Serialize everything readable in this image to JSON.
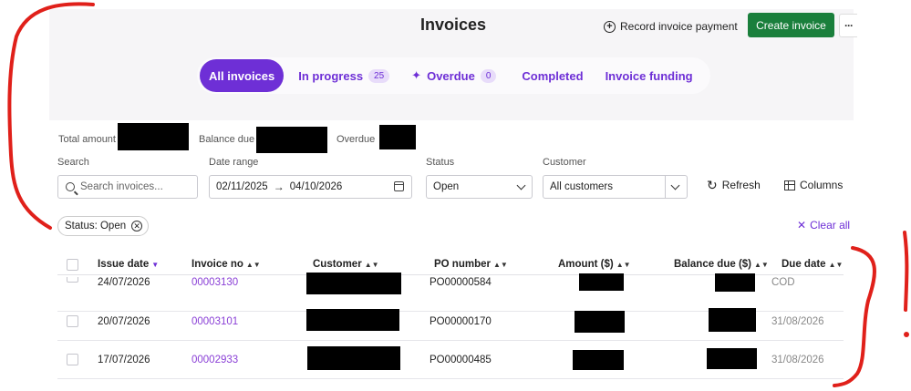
{
  "header": {
    "title": "Invoices",
    "record_payment_label": "Record invoice payment",
    "create_label": "Create invoice",
    "more_label": "···"
  },
  "tabs": [
    {
      "label": "All invoices",
      "active": true
    },
    {
      "label": "In progress",
      "count": "25"
    },
    {
      "label": "Overdue",
      "count": "0",
      "icon": "sparkle-icon"
    },
    {
      "label": "Completed"
    },
    {
      "label": "Invoice funding"
    }
  ],
  "summary": {
    "total_label": "Total amount",
    "balance_label": "Balance due",
    "overdue_label": "Overdue"
  },
  "filters": {
    "search_label": "Search",
    "search_placeholder": "Search invoices...",
    "date_label": "Date range",
    "date_from": "02/11/2025",
    "date_to": "04/10/2026",
    "status_label": "Status",
    "status_value": "Open",
    "customer_label": "Customer",
    "customer_value": "All customers",
    "refresh_label": "Refresh",
    "columns_label": "Columns"
  },
  "active_filter": {
    "chip_label": "Status: Open",
    "clear_all_label": "Clear all"
  },
  "table": {
    "columns": [
      "Issue date",
      "Invoice no",
      "Customer",
      "PO number",
      "Amount ($)",
      "Balance due ($)",
      "Due date"
    ],
    "rows": [
      {
        "issue_date": "24/07/2026",
        "invoice_no": "00003130",
        "po_number": "PO00000584",
        "due_date": "COD"
      },
      {
        "issue_date": "20/07/2026",
        "invoice_no": "00003101",
        "po_number": "PO00000170",
        "due_date": "31/08/2026"
      },
      {
        "issue_date": "17/07/2026",
        "invoice_no": "00002933",
        "po_number": "PO00000485",
        "due_date": "31/08/2026"
      }
    ]
  },
  "colors": {
    "accent": "#6e2fd6",
    "primary_button": "#1a7f3c",
    "annotation_red": "#e0201a"
  }
}
